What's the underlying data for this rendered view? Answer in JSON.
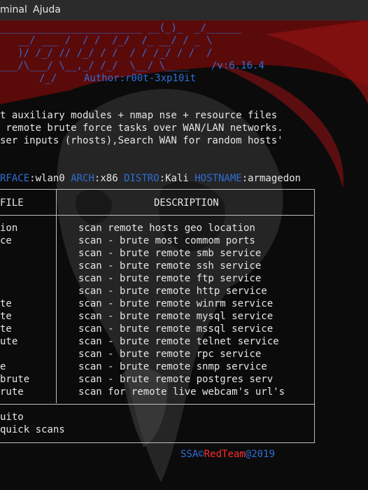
{
  "menu": {
    "items": [
      "minal",
      "Ajuda"
    ]
  },
  "banner": {
    "version": "/v:6.16.4",
    "author": "Author:r00t-3xp10it"
  },
  "description_lines": [
    "t auxiliary modules + nmap nse + resource files",
    " remote brute force tasks over WAN/LAN networks.",
    "ser inputs (rhosts),Search WAN for random hosts'"
  ],
  "sysinfo": {
    "interface_label": "RFACE",
    "interface_value": "wlan0",
    "arch_label": "ARCH",
    "arch_value": "x86",
    "distro_label": "DISTRO",
    "distro_value": "Kali",
    "hostname_label": "HOSTNAME",
    "hostname_value": "armagedon"
  },
  "table": {
    "headers": {
      "file": "FILE",
      "description": "DESCRIPTION"
    },
    "rows": [
      {
        "file": "ion",
        "desc": "scan remote hosts geo location"
      },
      {
        "file": "ce",
        "desc": "scan - brute most commom ports"
      },
      {
        "file": "",
        "desc": "scan - brute remote smb service"
      },
      {
        "file": "",
        "desc": "scan - brute remote ssh service"
      },
      {
        "file": "",
        "desc": "scan - brute remote ftp service"
      },
      {
        "file": "",
        "desc": "scan - brute remote http service"
      },
      {
        "file": "te",
        "desc": "scan - brute remote winrm service"
      },
      {
        "file": "te",
        "desc": "scan - brute remote mysql service"
      },
      {
        "file": "te",
        "desc": "scan - brute remote mssql service"
      },
      {
        "file": "ute",
        "desc": "scan - brute remote telnet service"
      },
      {
        "file": "",
        "desc": "scan - brute remote rpc service"
      },
      {
        "file": "e",
        "desc": "scan - brute remote snmp service"
      },
      {
        "file": "brute",
        "desc": "scan - brute remote postgres serv"
      },
      {
        "file": "rute",
        "desc": "scan for remote live webcam's url's"
      }
    ]
  },
  "footer_lines": [
    "uito",
    "quick scans"
  ],
  "credits": {
    "ssa": "SSA",
    "copy": "©",
    "redteam": "RedTeam",
    "at": "@",
    "year": "2019"
  },
  "colors": {
    "accent_blue": "#2f6fd6",
    "accent_red": "#ff2b2b",
    "background": "#0b0b0c"
  }
}
